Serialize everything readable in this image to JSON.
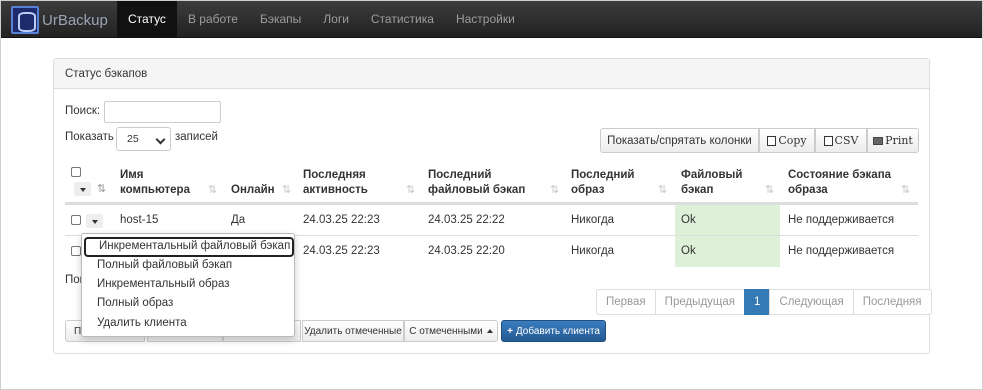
{
  "nav": {
    "brand": "UrBackup",
    "items": [
      "Статус",
      "В работе",
      "Бэкапы",
      "Логи",
      "Статистика",
      "Настройки"
    ]
  },
  "panel": {
    "title": "Статус бэкапов",
    "search_label": "Поиск:",
    "search_value": "",
    "show_label": "Показать",
    "page_size": "25",
    "entries_label": "записей",
    "buttons": {
      "toggle_columns": "Показать/спрятать колонки",
      "copy": "Copy",
      "csv": "CSV",
      "print": "Print"
    }
  },
  "table": {
    "headers": {
      "name": [
        "Имя",
        "компьютера"
      ],
      "online": "Онлайн",
      "last_seen": [
        "Последняя",
        "активность"
      ],
      "last_file": [
        "Последний",
        "файловый бэкап"
      ],
      "last_image": [
        "Последний",
        "образ"
      ],
      "file_ok": [
        "Файловый",
        "бэкап"
      ],
      "image_state": [
        "Состояние бэкапа",
        "образа"
      ]
    },
    "rows": [
      {
        "name": "host-15",
        "online": "Да",
        "last_seen": "24.03.25 22:23",
        "last_file": "24.03.25 22:22",
        "last_image": "Никогда",
        "file_ok": "Ok",
        "image_state": "Не поддерживается"
      },
      {
        "name": "",
        "online": "",
        "last_seen": "24.03.25 22:23",
        "last_file": "24.03.25 22:20",
        "last_image": "Никогда",
        "file_ok": "Ok",
        "image_state": "Не поддерживается"
      }
    ],
    "info_fragment": "Пок"
  },
  "pagination": {
    "first": "Первая",
    "prev": "Предыдущая",
    "current": "1",
    "next": "Следующая",
    "last": "Последняя"
  },
  "bottom": {
    "fragment_left": "По",
    "delete_selected": "Удалить отмеченные",
    "with_selected": "С отмеченными",
    "add_client": "Добавить клиента"
  },
  "menu": {
    "items": [
      "Инкрементальный файловый бэкап",
      "Полный файловый бэкап",
      "Инкрементальный образ",
      "Полный образ",
      "Удалить клиента"
    ]
  },
  "colors": {
    "accent": "#337ab7",
    "ok_bg": "#dff0d8",
    "navbar": "#222222"
  }
}
